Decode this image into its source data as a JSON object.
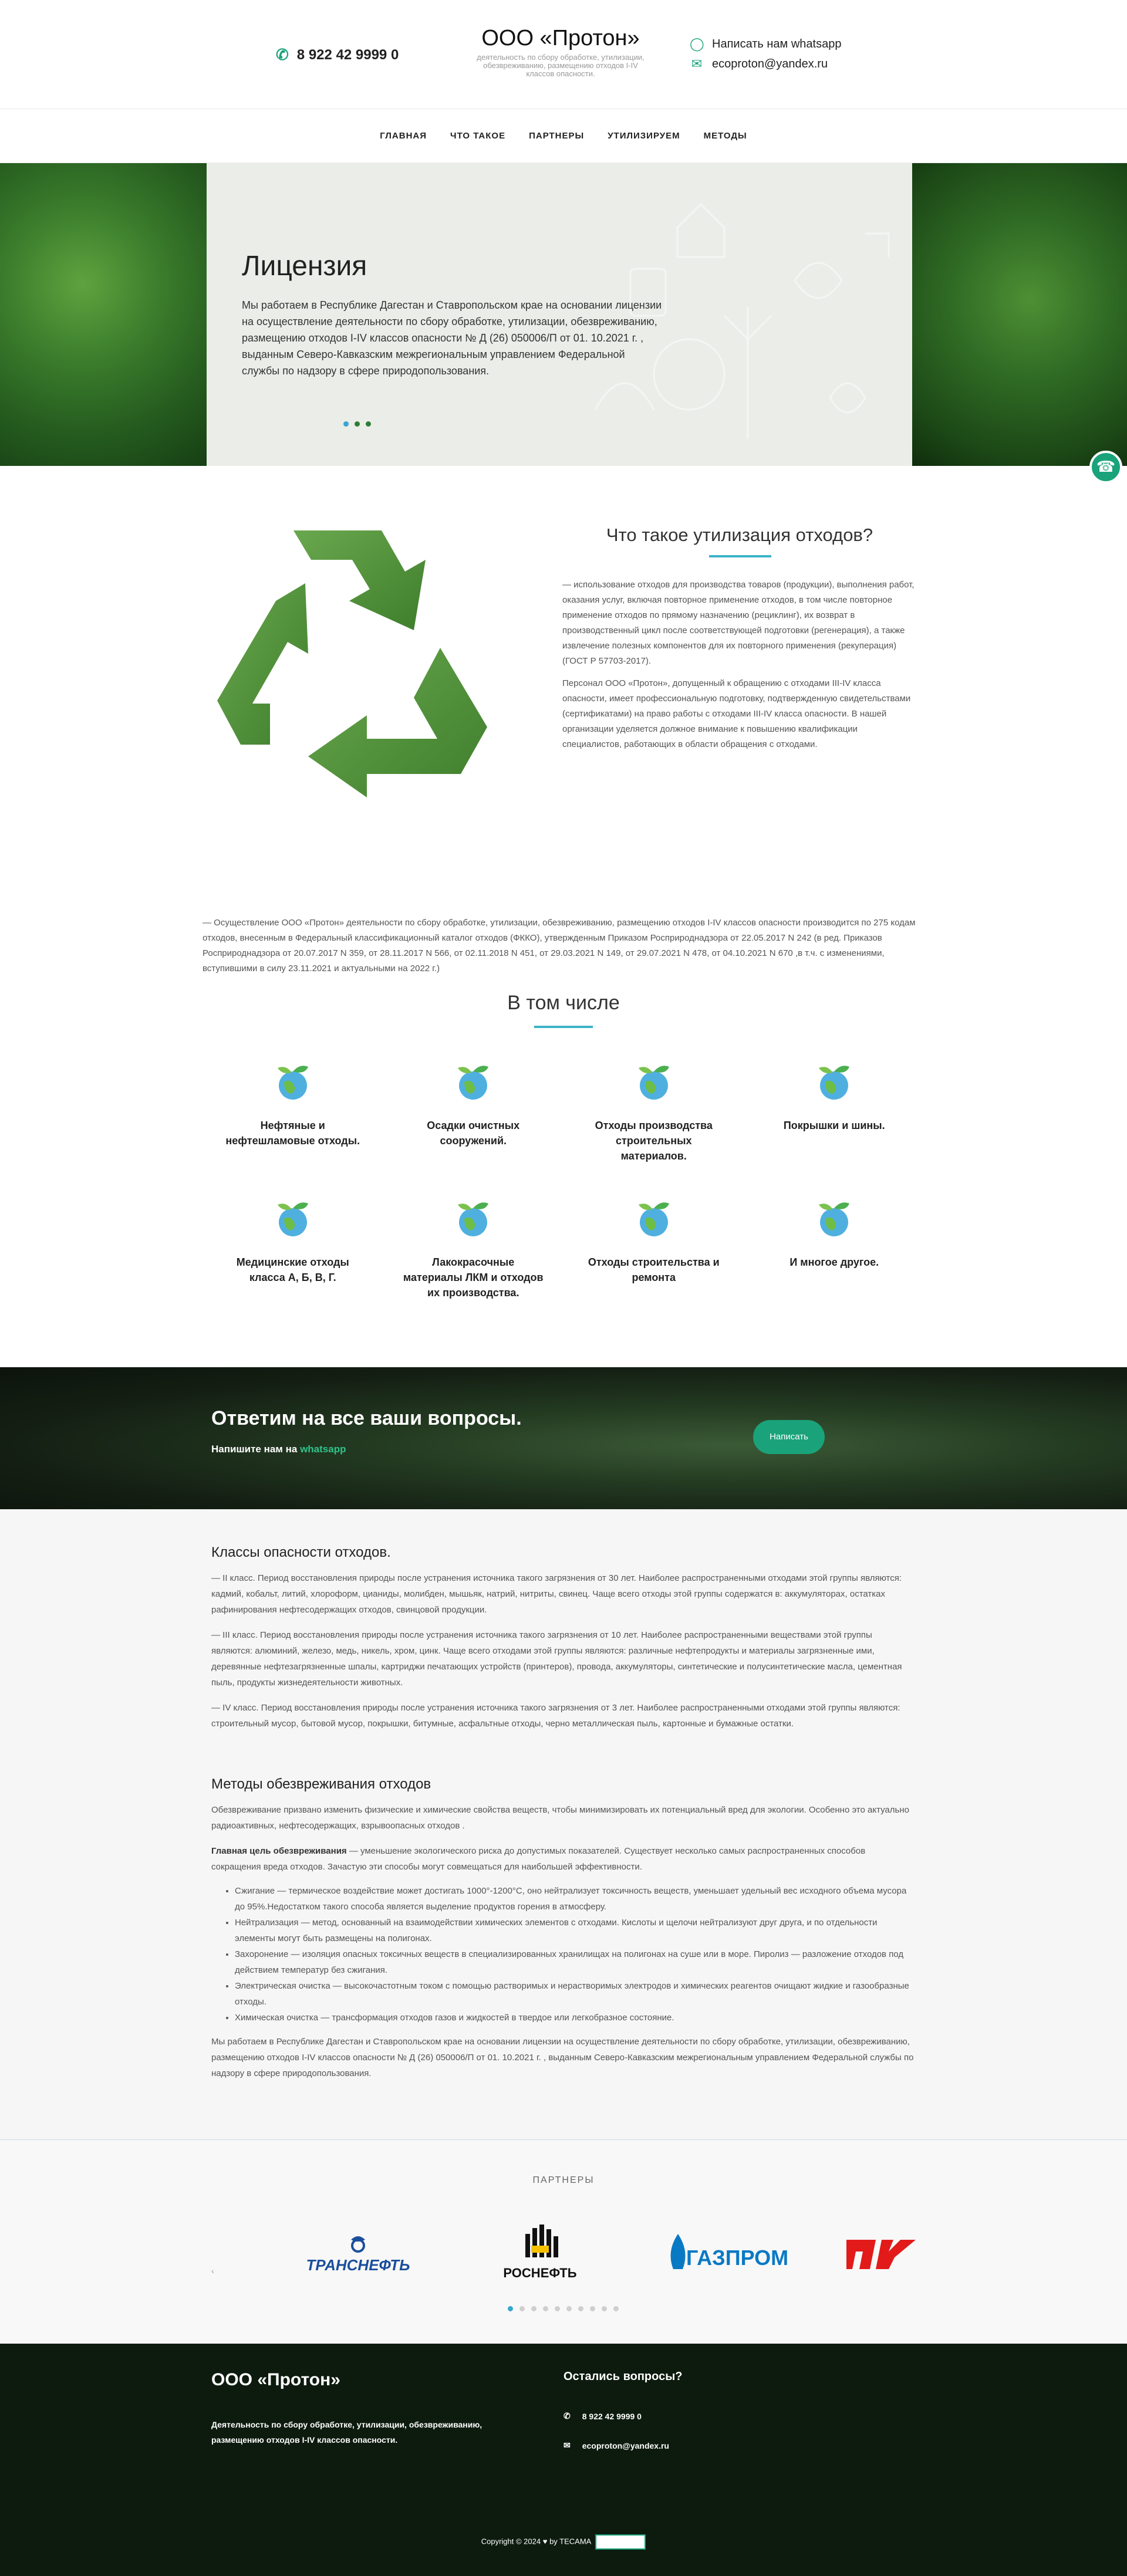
{
  "header": {
    "phone": "8 922 42 9999 0",
    "company": "ООО «Протон»",
    "tagline": "деятельность по сбору обработке, утилизации, обезвреживанию, размещению отходов I-IV классов опасности.",
    "whatsapp": "Написать нам whatsapp",
    "email": "ecoproton@yandex.ru"
  },
  "nav": [
    "ГЛАВНАЯ",
    "ЧТО ТАКОЕ",
    "ПАРТНЕРЫ",
    "УТИЛИЗИРУЕМ",
    "МЕТОДЫ"
  ],
  "slider": {
    "title": "Лицензия",
    "text": "Мы работаем в Республике Дагестан и Ставропольском крае на основании лицензии на осуществление деятельности по сбору обработке, утилизации, обезвреживанию, размещению отходов I-IV классов опасности № Д (26) 050006/П от 01. 10.2021 г. , выданным Северо-Кавказским межрегиональным управлением Федеральной службы по надзору в сфере природопользования."
  },
  "what": {
    "title": "Что такое утилизация отходов?",
    "p1": "— использование отходов для производства товаров (продукции), выполнения работ, оказания услуг, включая повторное применение отходов, в том числе повторное применение отходов по прямому назначению (рециклинг), их возврат в производственный цикл после соответствующей подготовки (регенерация), а также извлечение полезных компонентов для их повторного применения (рекуперация) (ГОСТ Р 57703-2017).",
    "p2": "Персонал ООО «Протон», допущенный к обращению с отходами III-IV класса опасности, имеет профессиональную подготовку, подтвержденную свидетельствами (сертификатами) на право работы с отходами III-IV класса опасности. В нашей организации уделяется должное внимание к повышению квалификации специалистов, работающих в области обращения с отходами."
  },
  "intro": "— Осуществление ООО «Протон» деятельности по сбору обработке, утилизации, обезвреживанию, размещению отходов I-IV классов опасности производится по 275 кодам отходов, внесенным в Федеральный классификационный каталог отходов (ФККО), утвержденным Приказом Росприроднадзора от 22.05.2017 N 242 (в ред. Приказов Росприроднадзора от 20.07.2017 N 359, от 28.11.2017 N 566, от 02.11.2018 N 451, от 29.03.2021 N 149, от 29.07.2021 N 478, от 04.10.2021 N 670 ,в т.ч. с изменениями, вступившими в силу 23.11.2021 и актуальными на 2022 г.)",
  "including": {
    "title": "В том числе",
    "items": [
      "Нефтяные и нефтешламовые отходы.",
      "Осадки очистных сооружений.",
      "Отходы производства строительных материалов.",
      "Покрышки и шины.",
      "Медицинские отходы класса А, Б, В, Г.",
      "Лакокрасочные материалы ЛКМ и отходов их производства.",
      "Отходы строительства и ремонта",
      "И многое другое."
    ]
  },
  "cta": {
    "title": "Ответим на все ваши вопросы.",
    "sub_prefix": "Напишите нам на",
    "sub_link": "whatsapp",
    "button": "Написать"
  },
  "classes": {
    "title": "Классы опасности отходов.",
    "items": [
      "— II класс. Период восстановления природы после устранения источника такого загрязнения от 30 лет. Наиболее распространенными отходами этой группы являются: кадмий, кобальт, литий, хлороформ, цианиды, молибден, мышьяк, натрий, нитриты, свинец. Чаще всего отходы этой группы содержатся в: аккумуляторах, остатках рафинирования нефтесодержащих отходов, свинцовой продукции.",
      "— III класс. Период восстановления природы после устранения источника такого загрязнения от 10 лет. Наиболее распространенными веществами этой группы являются: алюминий, железо, медь, никель, хром, цинк. Чаще всего отходами этой группы являются: различные нефтепродукты и материалы загрязненные ими, деревянные нефтезагрязненные шпалы, картриджи печатающих устройств (принтеров), провода, аккумуляторы, синтетические и полусинтетические масла, цементная пыль, продукты жизнедеятельности животных.",
      "— IV класс. Период восстановления природы после устранения источника такого загрязнения от 3 лет. Наиболее распространенными отходами этой группы являются: строительный мусор, бытовой мусор, покрышки, битумные, асфальтные отходы, черно металлическая пыль, картонные и бумажные остатки."
    ]
  },
  "methods": {
    "title": "Методы обезвреживания отходов",
    "p1": "Обезвреживание призвано изменить физические и химические свойства веществ, чтобы минимизировать их потенциальный вред для экологии. Особенно это актуально радиоактивных, нефтесодержащих, взрывоопасных отходов .",
    "goal_label": "Главная цель обезвреживания",
    "goal_text": " — уменьшение экологического риска до допустимых показателей. Существует несколько самых распространенных способов сокращения вреда отходов. Зачастую эти способы могут совмещаться для наибольшей эффективности.",
    "list": [
      "Сжигание — термическое воздействие может достигать 1000°-1200°С, оно нейтрализует токсичность веществ, уменьшает удельный вес исходного объема мусора до 95%.Недостатком такого способа является выделение продуктов горения в атмосферу.",
      "Нейтрализация — метод, основанный на взаимодействии химических элементов с отходами. Кислоты и щелочи нейтрализуют друг друга, и по отдельности элементы могут быть размещены на полигонах.",
      "Захоронение — изоляция опасных токсичных веществ в специализированных хранилищах на полигонах на суше или в море. Пиролиз — разложение отходов под действием температур без сжигания.",
      "Электрическая очистка — высокочастотным током с помощью растворимых и нерастворимых электродов и химических реагентов очищают жидкие и газообразные отходы.",
      "Химическая очистка — трансформация отходов газов и жидкостей в твердое или легкобразное состояние."
    ],
    "p_end": "Мы работаем в Республике Дагестан и Ставропольском крае на основании лицензии на осуществление деятельности по сбору обработке, утилизации, обезвреживанию, размещению отходов I-IV классов опасности № Д (26) 050006/П от 01. 10.2021 г. , выданным Северо-Кавказским межрегиональным управлением Федеральной службы по надзору в сфере природопользования."
  },
  "partners": {
    "title": "ПАРТНЕРЫ",
    "logos": [
      "ТРАНСНЕФТЬ",
      "РОСНЕФТЬ",
      "ГАЗПРОМ"
    ],
    "dots": 10
  },
  "footer": {
    "company": "ООО «Протон»",
    "desc": "Деятельность по сбору обработке, утилизации, обезвреживанию, размещению отходов I-IV классов опасности.",
    "questions": "Остались вопросы?",
    "phone": "8 922 42 9999 0",
    "email": "ecoproton@yandex.ru",
    "copyright": "Copyright © 2024",
    "by": "by TECAMA"
  },
  "colors": {
    "accent": "#1aa37a",
    "underline": "#3cb3c9",
    "footer_bg": "#0d1b0f"
  }
}
